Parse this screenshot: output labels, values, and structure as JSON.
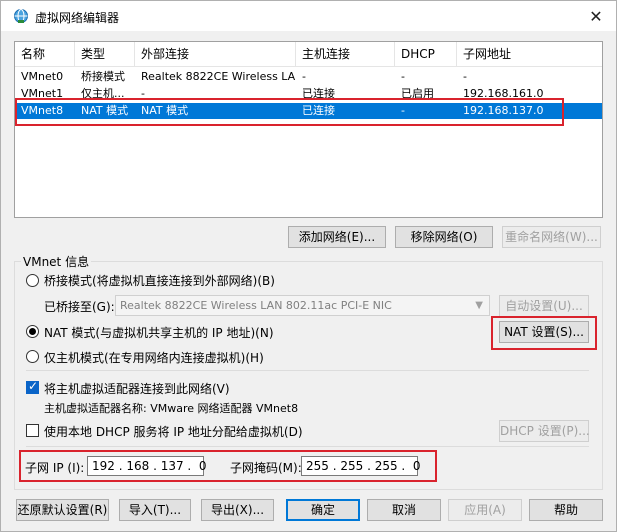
{
  "window": {
    "title": "虚拟网络编辑器",
    "close_glyph": "✕"
  },
  "list": {
    "headers": [
      "名称",
      "类型",
      "外部连接",
      "主机连接",
      "DHCP",
      "子网地址"
    ],
    "rows": [
      [
        "VMnet0",
        "桥接模式",
        "Realtek 8822CE Wireless LA...",
        "-",
        "-",
        "-"
      ],
      [
        "VMnet1",
        "仅主机...",
        "-",
        "已连接",
        "已启用",
        "192.168.161.0"
      ],
      [
        "VMnet8",
        "NAT 模式",
        "NAT 模式",
        "已连接",
        "-",
        "192.168.137.0"
      ]
    ],
    "selected_index": 2
  },
  "list_buttons": {
    "add": "添加网络(E)...",
    "remove": "移除网络(O)",
    "rename": "重命名网络(W)..."
  },
  "vmnet_info": {
    "group_label": "VMnet 信息",
    "bridged_label": "桥接模式(将虚拟机直接连接到外部网络)(B)",
    "bridged_to_label": "已桥接至(G):",
    "bridged_to_value": "Realtek 8822CE Wireless LAN 802.11ac PCI-E NIC",
    "auto_settings": "自动设置(U)...",
    "nat_label": "NAT 模式(与虚拟机共享主机的 IP 地址)(N)",
    "nat_settings": "NAT 设置(S)...",
    "hostonly_label": "仅主机模式(在专用网络内连接虚拟机)(H)",
    "connect_adapter_label": "将主机虚拟适配器连接到此网络(V)",
    "adapter_name_label": "主机虚拟适配器名称: VMware 网络适配器 VMnet8",
    "dhcp_label": "使用本地 DHCP 服务将 IP 地址分配给虚拟机(D)",
    "dhcp_settings": "DHCP 设置(P)...",
    "subnet_ip_label": "子网 IP (I):",
    "subnet_ip": "192 . 168 . 137 .  0",
    "subnet_mask_label": "子网掩码(M):",
    "subnet_mask": "255 . 255 . 255 .  0",
    "mode": "nat",
    "connect_adapter_checked": true,
    "dhcp_checked": false
  },
  "footer_buttons": {
    "restore": "还原默认设置(R)",
    "import": "导入(T)...",
    "export": "导出(X)...",
    "ok": "确定",
    "cancel": "取消",
    "apply": "应用(A)",
    "help": "帮助"
  },
  "colors": {
    "selection": "#0078d7",
    "highlight_box": "#d9232d"
  }
}
